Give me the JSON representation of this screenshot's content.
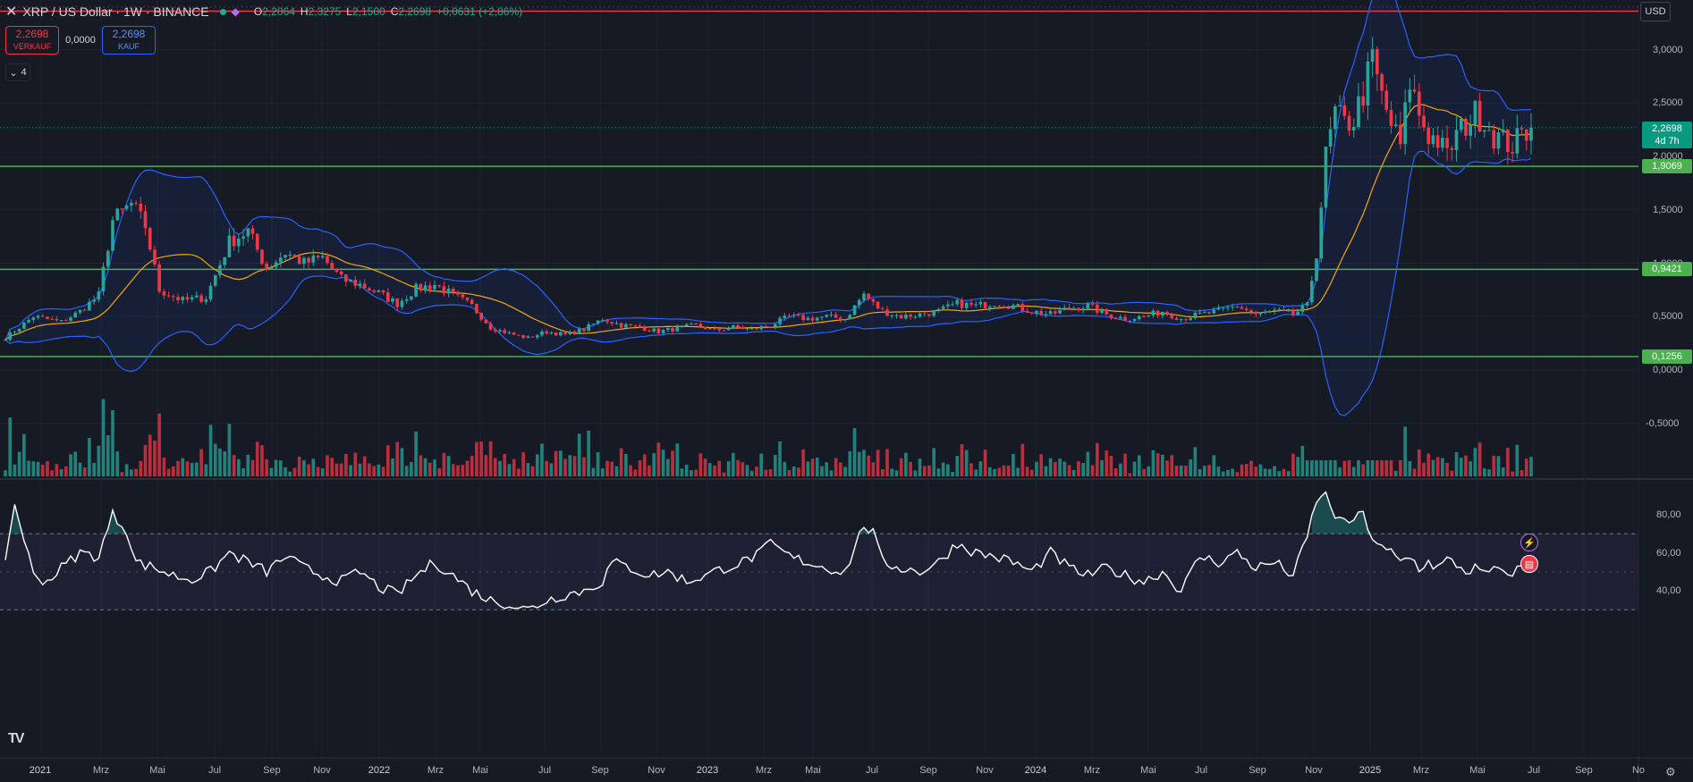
{
  "header": {
    "close_symbol": "✕",
    "symbol_title": "XRP / US Dollar · 1W · BINANCE",
    "ohlc": [
      {
        "key": "O",
        "value": "2,2064"
      },
      {
        "key": "H",
        "value": "2,3275"
      },
      {
        "key": "L",
        "value": "2,1500"
      },
      {
        "key": "C",
        "value": "2,2698"
      },
      {
        "key": "",
        "value": "+0,0631 (+2,86%)"
      }
    ],
    "status_dot_color": "#22ab94"
  },
  "trade": {
    "sell_price": "2,2698",
    "sell_label": "VERKAUF",
    "spread": "0,0000",
    "buy_price": "2,2698",
    "buy_label": "KAUF"
  },
  "indicator_toggle": {
    "chevron": "⌄",
    "count": "4"
  },
  "currency_button": "USD",
  "price_axis": {
    "labels": [
      "3,0000",
      "2,5000",
      "2,0000",
      "1,5000",
      "1,0000",
      "0,5000",
      "0,0000",
      "-0,5000"
    ],
    "values": [
      3.0,
      2.5,
      2.0,
      1.5,
      1.0,
      0.5,
      0.0,
      -0.5
    ]
  },
  "price_badge": {
    "price": "2,2698",
    "countdown": "4d 7h",
    "value": 2.2698,
    "color": "#089981"
  },
  "levels": [
    {
      "label": "1,9069",
      "value": 1.9069,
      "color": "#4caf50"
    },
    {
      "label": "0,9421",
      "value": 0.9421,
      "color": "#4caf50"
    },
    {
      "label": "0,1256",
      "value": 0.1256,
      "color": "#4caf50"
    }
  ],
  "resistance_line": {
    "value": 3.36,
    "color": "#f23645"
  },
  "rsi_axis": {
    "labels": [
      "80,00",
      "60,00",
      "40,00"
    ],
    "values": [
      80,
      60,
      40
    ],
    "upper_band": 70,
    "lower_band": 30
  },
  "time_axis": [
    {
      "label": "2021",
      "strong": true
    },
    {
      "label": "Mrz",
      "strong": false
    },
    {
      "label": "Mai",
      "strong": false
    },
    {
      "label": "Jul",
      "strong": false
    },
    {
      "label": "Sep",
      "strong": false
    },
    {
      "label": "Nov",
      "strong": false
    },
    {
      "label": "2022",
      "strong": true
    },
    {
      "label": "Mrz",
      "strong": false
    },
    {
      "label": "Mai",
      "strong": false
    },
    {
      "label": "Jul",
      "strong": false
    },
    {
      "label": "Sep",
      "strong": false
    },
    {
      "label": "Nov",
      "strong": false
    },
    {
      "label": "2023",
      "strong": true
    },
    {
      "label": "Mrz",
      "strong": false
    },
    {
      "label": "Mai",
      "strong": false
    },
    {
      "label": "Jul",
      "strong": false
    },
    {
      "label": "Sep",
      "strong": false
    },
    {
      "label": "Nov",
      "strong": false
    },
    {
      "label": "2024",
      "strong": true
    },
    {
      "label": "Mrz",
      "strong": false
    },
    {
      "label": "Mai",
      "strong": false
    },
    {
      "label": "Jul",
      "strong": false
    },
    {
      "label": "Sep",
      "strong": false
    },
    {
      "label": "Nov",
      "strong": false
    },
    {
      "label": "2025",
      "strong": true
    },
    {
      "label": "Mrz",
      "strong": false
    },
    {
      "label": "Mai",
      "strong": false
    },
    {
      "label": "Jul",
      "strong": false
    },
    {
      "label": "Sep",
      "strong": false
    },
    {
      "label": "No",
      "strong": false
    }
  ],
  "events": {
    "bolt_icon": "⚡",
    "flag_icon": "▤"
  },
  "logo": "TV",
  "settings_icon": "⚙",
  "colors": {
    "up": "#26a69a",
    "down": "#f23645",
    "bb": "#2962ff",
    "ma": "#f7a600",
    "rsi": "#ffffff"
  },
  "chart_data": {
    "type": "candlestick",
    "interval": "1W",
    "ylim": [
      -0.75,
      3.4
    ],
    "keyframes": [
      [
        0,
        0.3
      ],
      [
        6,
        0.5
      ],
      [
        12,
        0.45
      ],
      [
        16,
        0.55
      ],
      [
        20,
        0.7
      ],
      [
        23,
        1.4
      ],
      [
        27,
        1.55
      ],
      [
        30,
        1.35
      ],
      [
        33,
        0.75
      ],
      [
        38,
        0.65
      ],
      [
        43,
        0.68
      ],
      [
        48,
        1.2
      ],
      [
        52,
        1.3
      ],
      [
        56,
        0.95
      ],
      [
        60,
        1.1
      ],
      [
        64,
        1.0
      ],
      [
        68,
        1.05
      ],
      [
        72,
        0.85
      ],
      [
        76,
        0.8
      ],
      [
        80,
        0.72
      ],
      [
        84,
        0.62
      ],
      [
        88,
        0.76
      ],
      [
        92,
        0.8
      ],
      [
        96,
        0.7
      ],
      [
        100,
        0.6
      ],
      [
        104,
        0.4
      ],
      [
        108,
        0.34
      ],
      [
        112,
        0.3
      ],
      [
        116,
        0.36
      ],
      [
        120,
        0.33
      ],
      [
        124,
        0.38
      ],
      [
        128,
        0.48
      ],
      [
        132,
        0.42
      ],
      [
        136,
        0.4
      ],
      [
        140,
        0.36
      ],
      [
        144,
        0.39
      ],
      [
        148,
        0.42
      ],
      [
        152,
        0.37
      ],
      [
        156,
        0.4
      ],
      [
        160,
        0.38
      ],
      [
        164,
        0.42
      ],
      [
        168,
        0.5
      ],
      [
        172,
        0.48
      ],
      [
        176,
        0.5
      ],
      [
        180,
        0.48
      ],
      [
        184,
        0.71
      ],
      [
        186,
        0.62
      ],
      [
        188,
        0.55
      ],
      [
        192,
        0.5
      ],
      [
        196,
        0.52
      ],
      [
        200,
        0.55
      ],
      [
        204,
        0.62
      ],
      [
        208,
        0.6
      ],
      [
        212,
        0.63
      ],
      [
        216,
        0.6
      ],
      [
        220,
        0.55
      ],
      [
        224,
        0.52
      ],
      [
        228,
        0.58
      ],
      [
        232,
        0.6
      ],
      [
        236,
        0.52
      ],
      [
        240,
        0.48
      ],
      [
        244,
        0.5
      ],
      [
        248,
        0.55
      ],
      [
        252,
        0.48
      ],
      [
        256,
        0.52
      ],
      [
        260,
        0.55
      ],
      [
        264,
        0.6
      ],
      [
        268,
        0.52
      ],
      [
        272,
        0.55
      ],
      [
        276,
        0.52
      ],
      [
        279,
        0.6
      ],
      [
        281,
        1.1
      ],
      [
        283,
        2.0
      ],
      [
        285,
        2.4
      ],
      [
        287,
        2.3
      ],
      [
        289,
        2.35
      ],
      [
        291,
        2.6
      ],
      [
        293,
        2.9
      ],
      [
        295,
        2.55
      ],
      [
        297,
        2.3
      ],
      [
        299,
        2.1
      ],
      [
        301,
        2.7
      ],
      [
        303,
        2.4
      ],
      [
        305,
        2.2
      ],
      [
        307,
        2.15
      ],
      [
        309,
        2.0
      ],
      [
        311,
        2.2
      ],
      [
        313,
        2.3
      ],
      [
        315,
        2.4
      ],
      [
        317,
        2.35
      ],
      [
        319,
        2.2
      ],
      [
        321,
        2.15
      ],
      [
        323,
        2.1
      ],
      [
        325,
        2.2
      ],
      [
        327,
        2.27
      ]
    ],
    "rsi_keyframes": [
      [
        0,
        58
      ],
      [
        2,
        85
      ],
      [
        4,
        68
      ],
      [
        6,
        48
      ],
      [
        9,
        45
      ],
      [
        12,
        52
      ],
      [
        16,
        60
      ],
      [
        20,
        58
      ],
      [
        23,
        80
      ],
      [
        26,
        72
      ],
      [
        28,
        55
      ],
      [
        32,
        52
      ],
      [
        36,
        48
      ],
      [
        40,
        46
      ],
      [
        44,
        50
      ],
      [
        48,
        60
      ],
      [
        52,
        55
      ],
      [
        56,
        50
      ],
      [
        60,
        58
      ],
      [
        64,
        52
      ],
      [
        68,
        48
      ],
      [
        72,
        45
      ],
      [
        76,
        50
      ],
      [
        80,
        42
      ],
      [
        84,
        38
      ],
      [
        88,
        48
      ],
      [
        92,
        55
      ],
      [
        96,
        48
      ],
      [
        100,
        40
      ],
      [
        104,
        35
      ],
      [
        108,
        33
      ],
      [
        112,
        30
      ],
      [
        116,
        35
      ],
      [
        120,
        38
      ],
      [
        124,
        40
      ],
      [
        128,
        45
      ],
      [
        130,
        55
      ],
      [
        134,
        52
      ],
      [
        138,
        48
      ],
      [
        142,
        50
      ],
      [
        146,
        45
      ],
      [
        150,
        48
      ],
      [
        154,
        52
      ],
      [
        158,
        55
      ],
      [
        162,
        60
      ],
      [
        164,
        65
      ],
      [
        168,
        58
      ],
      [
        172,
        55
      ],
      [
        176,
        52
      ],
      [
        180,
        50
      ],
      [
        184,
        75
      ],
      [
        186,
        70
      ],
      [
        188,
        55
      ],
      [
        192,
        52
      ],
      [
        196,
        50
      ],
      [
        200,
        55
      ],
      [
        204,
        65
      ],
      [
        208,
        60
      ],
      [
        212,
        58
      ],
      [
        216,
        55
      ],
      [
        220,
        50
      ],
      [
        224,
        60
      ],
      [
        228,
        52
      ],
      [
        232,
        48
      ],
      [
        236,
        52
      ],
      [
        240,
        48
      ],
      [
        244,
        45
      ],
      [
        248,
        50
      ],
      [
        252,
        40
      ],
      [
        256,
        58
      ],
      [
        260,
        55
      ],
      [
        264,
        60
      ],
      [
        268,
        52
      ],
      [
        272,
        55
      ],
      [
        276,
        48
      ],
      [
        279,
        68
      ],
      [
        281,
        88
      ],
      [
        283,
        90
      ],
      [
        285,
        80
      ],
      [
        287,
        75
      ],
      [
        289,
        78
      ],
      [
        291,
        80
      ],
      [
        293,
        68
      ],
      [
        295,
        62
      ],
      [
        297,
        60
      ],
      [
        299,
        55
      ],
      [
        301,
        58
      ],
      [
        303,
        52
      ],
      [
        305,
        55
      ],
      [
        307,
        52
      ],
      [
        309,
        56
      ],
      [
        311,
        54
      ],
      [
        313,
        50
      ],
      [
        315,
        52
      ],
      [
        317,
        48
      ],
      [
        319,
        52
      ],
      [
        321,
        48
      ],
      [
        323,
        50
      ],
      [
        325,
        52
      ],
      [
        327,
        53
      ]
    ],
    "bars": 328,
    "overlays": [
      "Bollinger Bands",
      "Moving Average"
    ],
    "lower_pane": "RSI"
  }
}
